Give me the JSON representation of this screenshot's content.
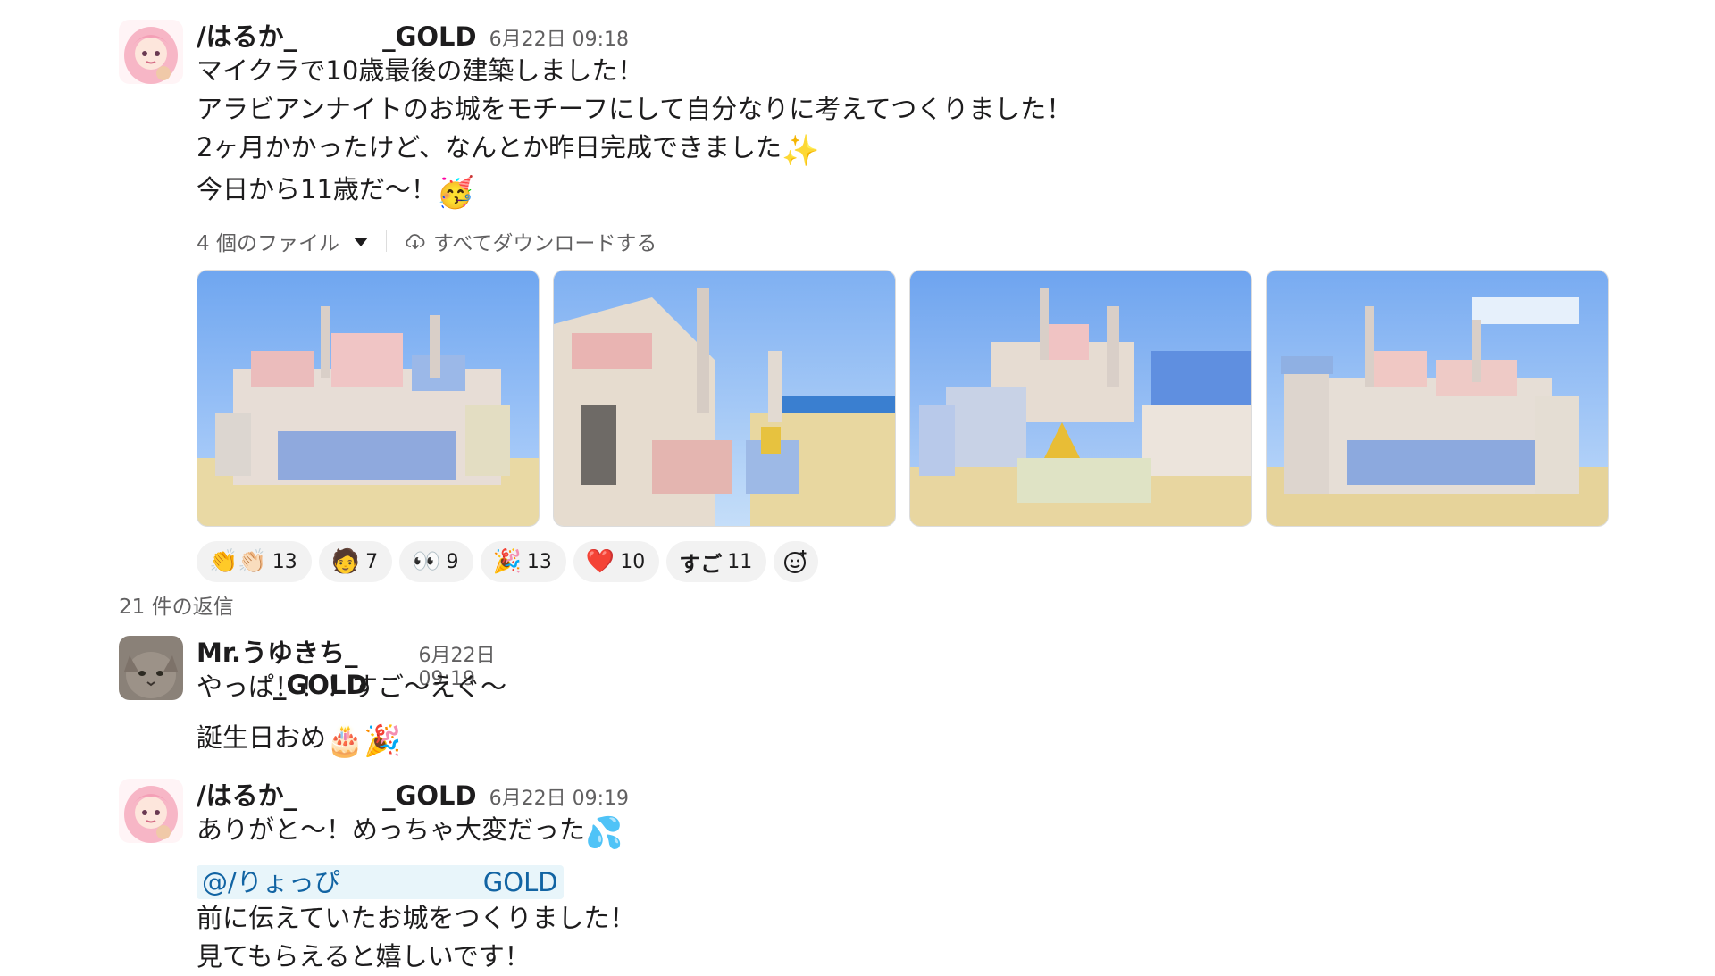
{
  "main_post": {
    "author_prefix": "/はるか_",
    "author_suffix": "_GOLD",
    "time": "6月22日 09:18",
    "lines": [
      "マイクラで10歳最後の建築しました！",
      "アラビアンナイトのお城をモチーフにして自分なりに考えてつくりました！",
      "2ヶ月かかったけど、なんとか昨日完成できました",
      "今日から11歳だ〜！"
    ],
    "line3_emoji": "✨",
    "line4_emoji": "🥳",
    "files_label": "4 個のファイル",
    "download_label": "すべてダウンロードする"
  },
  "reactions": [
    {
      "emoji": "👏👏🏻",
      "count": "13"
    },
    {
      "emoji": "🧑",
      "count": "7"
    },
    {
      "emoji": "👀",
      "count": "9"
    },
    {
      "emoji": "🎉",
      "count": "13"
    },
    {
      "emoji": "❤️",
      "count": "10"
    },
    {
      "emoji": "すご",
      "count": "11"
    }
  ],
  "replies_count": "21 件の返信",
  "reply1": {
    "author_prefix": "Mr.うゆきち_",
    "author_suffix": "_GOLD",
    "time": "6月22日 09:19",
    "line1": "やっぱ！！！すご〜えぐ〜",
    "line2": "誕生日おめ",
    "line2_emoji": "🎂🎉"
  },
  "reply2": {
    "author_prefix": "/はるか_",
    "author_suffix": "_GOLD",
    "time": "6月22日 09:19",
    "line1": "ありがと〜！めっちゃ大変だった",
    "line1_emoji": "💦",
    "mention_prefix": "@/りょっぴ",
    "mention_suffix": "GOLD",
    "line2": "前に伝えていたお城をつくりました！",
    "line3": "見てもらえると嬉しいです！"
  },
  "colors": {
    "link": "#1264a3",
    "mention_bg": "#e8f5fa",
    "meta_text": "#616061",
    "reaction_bg": "#f2f2f2"
  }
}
